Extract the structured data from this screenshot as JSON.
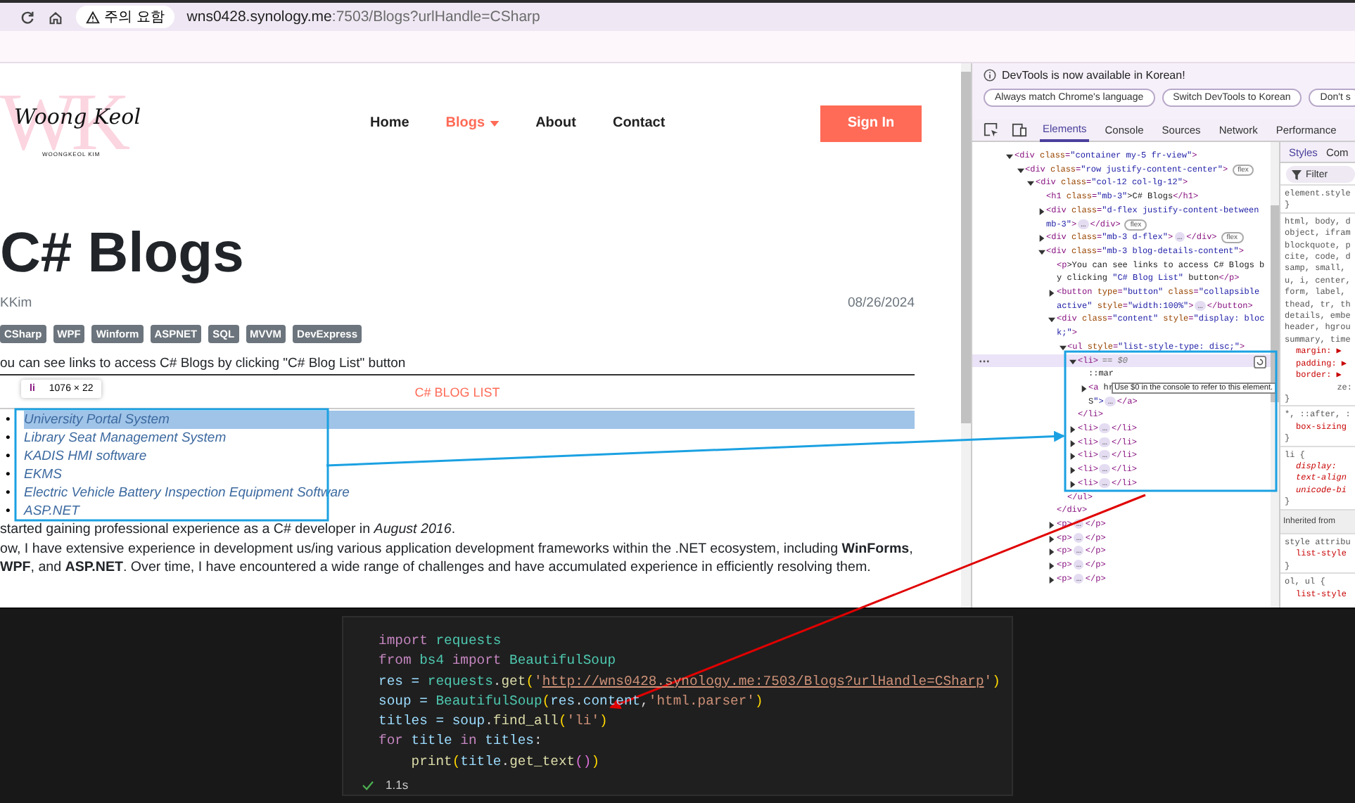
{
  "browser": {
    "security": "주의 요함",
    "host": "wns0428.synology.me",
    "path": ":7503/Blogs?urlHandle=CSharp"
  },
  "page": {
    "logo": {
      "letters": "WK",
      "script": "Woong Keol",
      "caption": "WOONGKEOL KIM"
    },
    "nav": [
      {
        "label": "Home",
        "selected": false,
        "dropdown": false
      },
      {
        "label": "Blogs",
        "selected": true,
        "dropdown": true
      },
      {
        "label": "About",
        "selected": false,
        "dropdown": false
      },
      {
        "label": "Contact",
        "selected": false,
        "dropdown": false
      }
    ],
    "sign_in": "Sign In",
    "title": "C# Blogs",
    "author": "KKim",
    "date": "08/26/2024",
    "tags": [
      "CSharp",
      "WPF",
      "Winform",
      "ASPNET",
      "SQL",
      "MVVM",
      "DevExpress"
    ],
    "intro": "ou can see links to access C# Blogs by clicking \"C# Blog List\" button",
    "list_button": "C# BLOG LIST",
    "inspect_tooltip": {
      "tag": "li",
      "size": "1076 × 22"
    },
    "blog_links": [
      {
        "marker": "•",
        "label": "University Portal System",
        "selected": true
      },
      {
        "marker": "•",
        "label": "Library Seat Management System",
        "selected": false
      },
      {
        "marker": "•",
        "label": "KADIS HMI software",
        "selected": false
      },
      {
        "marker": "•",
        "label": "EKMS",
        "selected": false
      },
      {
        "marker": "•",
        "label": "Electric Vehicle Battery Inspection Equipment Software",
        "selected": false
      },
      {
        "marker": "•",
        "label": "ASP.NET",
        "selected": false
      }
    ],
    "paragraphs": [
      "started gaining professional experience as a C# developer in *August 2016*.",
      "ow, I have extensive experience in development us/ing various application development frameworks within the .NET ecosystem, including **WinForms**, **WPF**, and **ASP.NET**. Over time, I have encountered a wide range of challenges and have accumulated experience in efficiently resolving them."
    ]
  },
  "devtools": {
    "notice": "DevTools is now available in Korean!",
    "notice_buttons": [
      "Always match Chrome's language",
      "Switch DevTools to Korean",
      "Don't s"
    ],
    "tabs": [
      {
        "label": "Elements",
        "selected": true
      },
      {
        "label": "Console",
        "selected": false
      },
      {
        "label": "Sources",
        "selected": false
      },
      {
        "label": "Network",
        "selected": false
      },
      {
        "label": "Performance",
        "selected": false
      }
    ],
    "element_tooltip": "Use $0 in the console to refer to this element.",
    "elements": [
      {
        "open": "<div class=\"container my-5 fr-view\">",
        "expanded": true,
        "selected": false,
        "children": [
          {
            "open": "<div class=\"row justify-content-center\">",
            "badge": "flex",
            "expanded": true,
            "selected": false,
            "children": [
              {
                "open": "<div class=\"col-12 col-lg-12\">",
                "expanded": true,
                "selected": false,
                "children": [
                  {
                    "open": "<h1 class=\"mb-3\">C# Blogs</h1>",
                    "selected": false
                  },
                  {
                    "open": "<div class=\"d-flex justify-content-between mb-3\">",
                    "expanded": false,
                    "ellipsis": "…",
                    "tail": "</div>",
                    "badge": "flex",
                    "selected": false
                  },
                  {
                    "open": "<div class=\"mb-3 d-flex\">",
                    "expanded": false,
                    "ellipsis": "…",
                    "tail": "</div>",
                    "badge": "flex",
                    "selected": false
                  },
                  {
                    "open": "<div class=\"mb-3 blog-details-content\">",
                    "expanded": true,
                    "selected": false,
                    "children": [
                      {
                        "open": "<p>You can see links to access C# Blogs by clicking \"C# Blog List\" button</p>",
                        "selected": false
                      },
                      {
                        "open": "<button type=\"button\" class=\"collapsible active\" style=\"width:100%\">",
                        "expanded": false,
                        "ellipsis": "…",
                        "tail": "</button>",
                        "selected": false
                      },
                      {
                        "open": "<div class=\"content\" style=\"display: block;\">",
                        "expanded": true,
                        "close": "</div>",
                        "selected": false,
                        "children": [
                          {
                            "open": "<ul style=\"list-style-type: disc;\">",
                            "expanded": true,
                            "close": "</ul>",
                            "selected": false,
                            "children": [
                              {
                                "open": "<li>",
                                "dollar": "== $0",
                                "expanded": true,
                                "close": "</li>",
                                "selected": true,
                                "children": [
                                  {
                                    "open": "::mar",
                                    "selected": false
                                  },
                                  {
                                    "open": "<a hr",
                                    "cont": "S\">",
                                    "expanded": false,
                                    "ellipsis": "…",
                                    "tail": "</a>",
                                    "selected": false
                                  }
                                ]
                              },
                              {
                                "open": "<li>",
                                "expanded": false,
                                "ellipsis": "…",
                                "tail": "</li>",
                                "selected": false
                              },
                              {
                                "open": "<li>",
                                "expanded": false,
                                "ellipsis": "…",
                                "tail": "</li>",
                                "selected": false
                              },
                              {
                                "open": "<li>",
                                "expanded": false,
                                "ellipsis": "…",
                                "tail": "</li>",
                                "selected": false
                              },
                              {
                                "open": "<li>",
                                "expanded": false,
                                "ellipsis": "…",
                                "tail": "</li>",
                                "selected": false
                              },
                              {
                                "open": "<li>",
                                "expanded": false,
                                "ellipsis": "…",
                                "tail": "</li>",
                                "selected": false
                              }
                            ]
                          }
                        ]
                      },
                      {
                        "open": "<p>",
                        "expanded": false,
                        "ellipsis": "…",
                        "tail": "</p>",
                        "selected": false
                      },
                      {
                        "open": "<p>",
                        "expanded": false,
                        "ellipsis": "…",
                        "tail": "</p>",
                        "selected": false
                      },
                      {
                        "open": "<p>",
                        "expanded": false,
                        "ellipsis": "…",
                        "tail": "</p>",
                        "selected": false
                      },
                      {
                        "open": "<p>",
                        "expanded": false,
                        "ellipsis": "…",
                        "tail": "</p>",
                        "selected": false
                      },
                      {
                        "open": "<p>",
                        "expanded": false,
                        "ellipsis": "…",
                        "tail": "</p>",
                        "selected": false
                      }
                    ]
                  }
                ]
              }
            ]
          }
        ]
      }
    ],
    "styles": {
      "tabs": [
        {
          "label": "Styles",
          "selected": true
        },
        {
          "label": "Com",
          "selected": false
        }
      ],
      "filter_placeholder": "Filter",
      "lines": [
        {
          "text": "element.style",
          "kind": "selector"
        },
        {
          "text": "}",
          "kind": "brace"
        },
        {
          "text": "html, body, d",
          "kind": "selector"
        },
        {
          "text": "object, ifram",
          "kind": "plain"
        },
        {
          "text": "blockquote, p",
          "kind": "plain"
        },
        {
          "text": "cite, code, d",
          "kind": "plain"
        },
        {
          "text": "samp, small,",
          "kind": "plain"
        },
        {
          "text": "u, i, center,",
          "kind": "plain"
        },
        {
          "text": "form, label,",
          "kind": "plain"
        },
        {
          "text": "thead, tr, th",
          "kind": "plain"
        },
        {
          "text": "details, embe",
          "kind": "plain"
        },
        {
          "text": "header, hgrou",
          "kind": "plain"
        },
        {
          "text": "summary, time",
          "kind": "plain"
        },
        {
          "text": "margin: ▶",
          "kind": "prop"
        },
        {
          "text": "padding: ▶",
          "kind": "prop"
        },
        {
          "text": "border: ▶",
          "kind": "prop"
        },
        {
          "text": "ze:",
          "kind": "tail"
        },
        {
          "text": "}",
          "kind": "brace"
        },
        {
          "text": "*, ::after, :",
          "kind": "selector"
        },
        {
          "text": "box-sizing",
          "kind": "prop"
        },
        {
          "text": "}",
          "kind": "brace"
        },
        {
          "text": "li {",
          "kind": "selector"
        },
        {
          "text": "display:",
          "kind": "ua-prop"
        },
        {
          "text": "text-align",
          "kind": "ua-prop"
        },
        {
          "text": "unicode-bi",
          "kind": "ua-prop"
        },
        {
          "text": "}",
          "kind": "brace"
        },
        {
          "text": "Inherited from",
          "kind": "header"
        },
        {
          "text": "style attribu",
          "kind": "selector"
        },
        {
          "text": "list-style",
          "kind": "prop"
        },
        {
          "text": "}",
          "kind": "brace"
        },
        {
          "text": "ol, ul {",
          "kind": "selector"
        },
        {
          "text": "list-style",
          "kind": "prop"
        }
      ]
    }
  },
  "notebook": {
    "code": [
      {
        "tokens": [
          {
            "text": "import ",
            "kind": "kw"
          },
          {
            "text": "requests",
            "kind": "mod"
          }
        ]
      },
      {
        "tokens": [
          {
            "text": "from ",
            "kind": "kw"
          },
          {
            "text": "bs4 ",
            "kind": "mod"
          },
          {
            "text": "import ",
            "kind": "kw"
          },
          {
            "text": "BeautifulSoup",
            "kind": "mod"
          }
        ]
      },
      {
        "tokens": [
          {
            "text": "res =",
            "kind": "var"
          },
          {
            "text": " requests",
            "kind": "mod"
          },
          {
            "text": ".",
            "kind": "op"
          },
          {
            "text": "get",
            "kind": "fn"
          },
          {
            "text": "(",
            "kind": "p1"
          },
          {
            "text": "'",
            "kind": "str"
          },
          {
            "text": "http://wns0428.synology.me:7503/Blogs?urlHandle=CSharp",
            "kind": "link"
          },
          {
            "text": "'",
            "kind": "str"
          },
          {
            "text": ")",
            "kind": "p1"
          }
        ]
      },
      {
        "tokens": [
          {
            "text": "soup =",
            "kind": "var"
          },
          {
            "text": " BeautifulSoup",
            "kind": "mod"
          },
          {
            "text": "(",
            "kind": "p1"
          },
          {
            "text": "res",
            "kind": "var"
          },
          {
            "text": ".",
            "kind": "op"
          },
          {
            "text": "content",
            "kind": "var"
          },
          {
            "text": ",",
            "kind": "op"
          },
          {
            "text": "'html.parser'",
            "kind": "str"
          },
          {
            "text": ")",
            "kind": "p1"
          }
        ]
      },
      {
        "tokens": [
          {
            "text": "titles =",
            "kind": "var"
          },
          {
            "text": " soup",
            "kind": "var"
          },
          {
            "text": ".",
            "kind": "op"
          },
          {
            "text": "find_all",
            "kind": "fn"
          },
          {
            "text": "(",
            "kind": "p1"
          },
          {
            "text": "'li'",
            "kind": "str"
          },
          {
            "text": ")",
            "kind": "p1"
          }
        ]
      },
      {
        "tokens": [
          {
            "text": "for ",
            "kind": "kw"
          },
          {
            "text": "title ",
            "kind": "var"
          },
          {
            "text": "in ",
            "kind": "kw"
          },
          {
            "text": "titles",
            "kind": "var"
          },
          {
            "text": ":",
            "kind": "op"
          }
        ]
      },
      {
        "tokens": [
          {
            "text": "    print",
            "kind": "fn"
          },
          {
            "text": "(",
            "kind": "p1"
          },
          {
            "text": "title",
            "kind": "var"
          },
          {
            "text": ".",
            "kind": "op"
          },
          {
            "text": "get_text",
            "kind": "fn"
          },
          {
            "text": "()",
            "kind": "p2"
          },
          {
            "text": ")",
            "kind": "p1"
          }
        ]
      }
    ],
    "status": "1.1s"
  }
}
